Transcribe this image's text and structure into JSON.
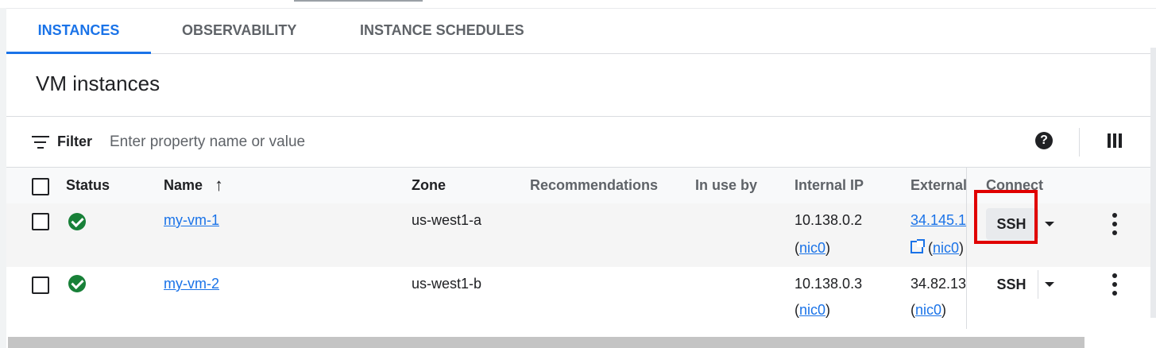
{
  "tabs": [
    {
      "label": "INSTANCES",
      "active": true
    },
    {
      "label": "OBSERVABILITY",
      "active": false
    },
    {
      "label": "INSTANCE SCHEDULES",
      "active": false
    }
  ],
  "page_title": "VM instances",
  "filter": {
    "label": "Filter",
    "placeholder": "Enter property name or value",
    "help_icon": "?"
  },
  "table": {
    "headers": {
      "status": "Status",
      "name": "Name",
      "sort_arrow": "↑",
      "zone": "Zone",
      "recommendations": "Recommendations",
      "in_use_by": "In use by",
      "internal_ip": "Internal IP",
      "external_ip": "External",
      "connect": "Connect"
    },
    "rows": [
      {
        "status": "running",
        "name": "my-vm-1",
        "zone": "us-west1-a",
        "internal_ip": "10.138.0.2",
        "internal_nic": "nic0",
        "external_ip": "34.145.1",
        "external_nic": "nic0",
        "connect": "SSH"
      },
      {
        "status": "running",
        "name": "my-vm-2",
        "zone": "us-west1-b",
        "internal_ip": "10.138.0.3",
        "internal_nic": "nic0",
        "external_ip": "34.82.13",
        "external_nic": "nic0",
        "connect": "SSH"
      }
    ]
  },
  "colors": {
    "accent": "#1a73e8",
    "status_ok": "#188038",
    "highlight": "#e00000"
  }
}
